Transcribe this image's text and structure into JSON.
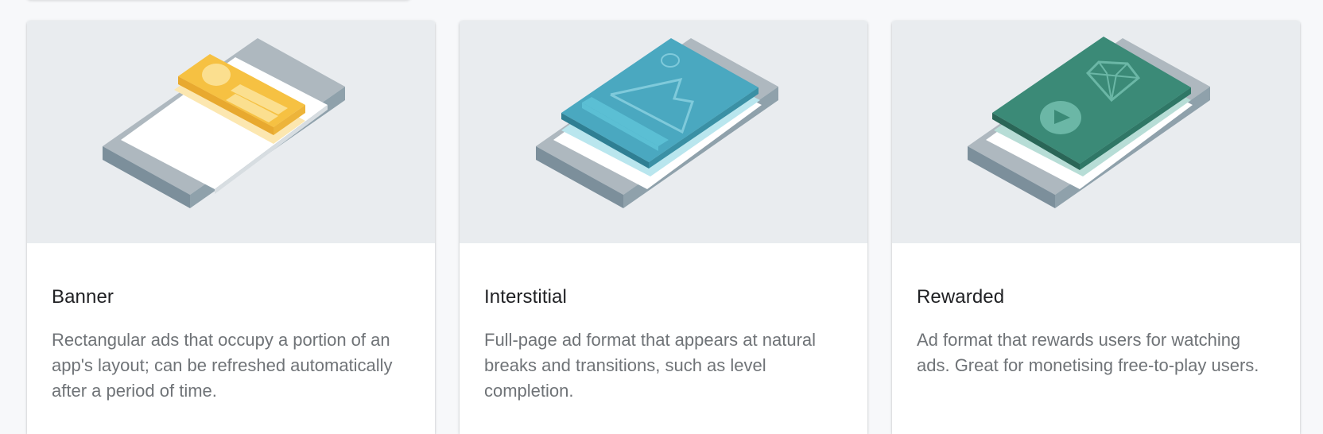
{
  "cards": [
    {
      "title": "Banner",
      "description": "Rectangular ads that occupy a portion of an app's layout; can be refreshed automatically after a period of time.",
      "illustration": "banner-ad-phone-illustration",
      "accent": "#f6c142"
    },
    {
      "title": "Interstitial",
      "description": "Full-page ad format that appears at natural breaks and transitions, such as level completion.",
      "illustration": "interstitial-ad-phone-illustration",
      "accent": "#4aa8c0"
    },
    {
      "title": "Rewarded",
      "description": "Ad format that rewards users for watching ads. Great for monetising free-to-play users.",
      "illustration": "rewarded-ad-phone-illustration",
      "accent": "#3b8a77"
    }
  ]
}
